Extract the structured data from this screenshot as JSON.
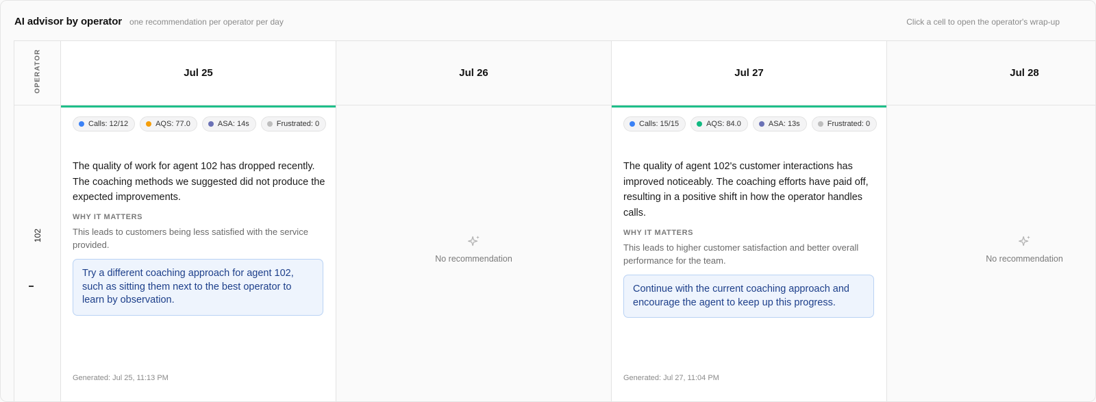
{
  "header": {
    "title": "AI advisor by operator",
    "subtitle": "one recommendation per operator per day",
    "hint": "Click a cell to open the operator's wrap-up"
  },
  "grid": {
    "operator_column_label": "OPERATOR",
    "days": [
      "Jul 25",
      "Jul 26",
      "Jul 27",
      "Jul 28"
    ],
    "operators": [
      {
        "id": "102",
        "status": "-",
        "cells": [
          {
            "chips": [
              {
                "label": "Calls: 12/12",
                "color": "#3b82f6"
              },
              {
                "label": "AQS: 77.0",
                "color": "#f59e0b"
              },
              {
                "label": "ASA: 14s",
                "color": "#6b72b6"
              },
              {
                "label": "Frustrated: 0",
                "color": "#bdbdbd"
              }
            ],
            "summary": "The quality of work for agent 102 has dropped recently. The coaching methods we suggested did not produce the expected improvements.",
            "why_label": "WHY IT MATTERS",
            "why_text": "This leads to customers being less satisfied with the service provided.",
            "recommendation": "Try a different coaching approach for agent 102, such as sitting them next to the best operator to learn by observation.",
            "generated": "Generated: Jul 25, 11:13 PM"
          },
          {
            "empty_text": "No recommendation"
          },
          {
            "chips": [
              {
                "label": "Calls: 15/15",
                "color": "#3b82f6"
              },
              {
                "label": "AQS: 84.0",
                "color": "#10b981"
              },
              {
                "label": "ASA: 13s",
                "color": "#6b72b6"
              },
              {
                "label": "Frustrated: 0",
                "color": "#bdbdbd"
              }
            ],
            "summary": "The quality of agent 102's customer interactions has improved noticeably. The coaching efforts have paid off, resulting in a positive shift in how the operator handles calls.",
            "why_label": "WHY IT MATTERS",
            "why_text": "This leads to higher customer satisfaction and better overall performance for the team.",
            "recommendation": "Continue with the current coaching approach and encourage the agent to keep up this progress.",
            "generated": "Generated: Jul 27, 11:04 PM"
          },
          {
            "empty_text": "No recommendation"
          }
        ]
      }
    ]
  },
  "colors": {
    "accent_green": "#1fbf8a",
    "recommendation_bg": "#eef4fd",
    "recommendation_border": "#b9d2f4",
    "recommendation_text": "#1d3f8a"
  },
  "icons": {
    "empty_state": "sparkle-icon"
  }
}
